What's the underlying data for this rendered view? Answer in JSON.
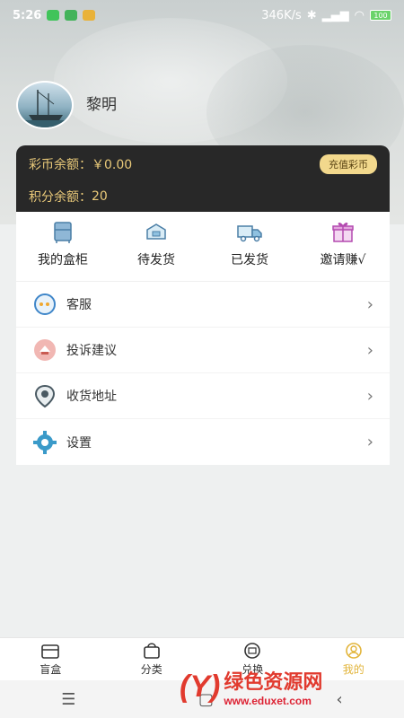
{
  "status_bar": {
    "time": "5:26",
    "network_speed": "346K/s",
    "battery": "100"
  },
  "profile": {
    "username": "黎明"
  },
  "balance": {
    "coin_label": "彩币余额：",
    "coin_value": "￥0.00",
    "recharge_label": "充值彩币",
    "points_label": "积分余额：",
    "points_value": "20"
  },
  "quick_actions": [
    {
      "label": "我的盒柜",
      "icon": "cabinet-icon"
    },
    {
      "label": "待发货",
      "icon": "box-pending-icon"
    },
    {
      "label": "已发货",
      "icon": "truck-icon"
    },
    {
      "label": "邀请赚√",
      "icon": "gift-icon"
    }
  ],
  "menu": [
    {
      "label": "客服",
      "icon": "customer-service-icon"
    },
    {
      "label": "投诉建议",
      "icon": "feedback-icon"
    },
    {
      "label": "收货地址",
      "icon": "location-icon"
    },
    {
      "label": "设置",
      "icon": "gear-icon"
    }
  ],
  "tabs": [
    {
      "label": "盲盒",
      "icon": "blind-box-icon"
    },
    {
      "label": "分类",
      "icon": "category-bag-icon"
    },
    {
      "label": "兑换",
      "icon": "exchange-icon"
    },
    {
      "label": "我的",
      "icon": "profile-icon",
      "active": true
    }
  ],
  "watermark": {
    "name": "绿色资源网",
    "url": "www.eduxet.com"
  },
  "colors": {
    "accent_gold": "#e9c979",
    "card_bg": "#282828",
    "tab_active": "#e2b43a"
  }
}
